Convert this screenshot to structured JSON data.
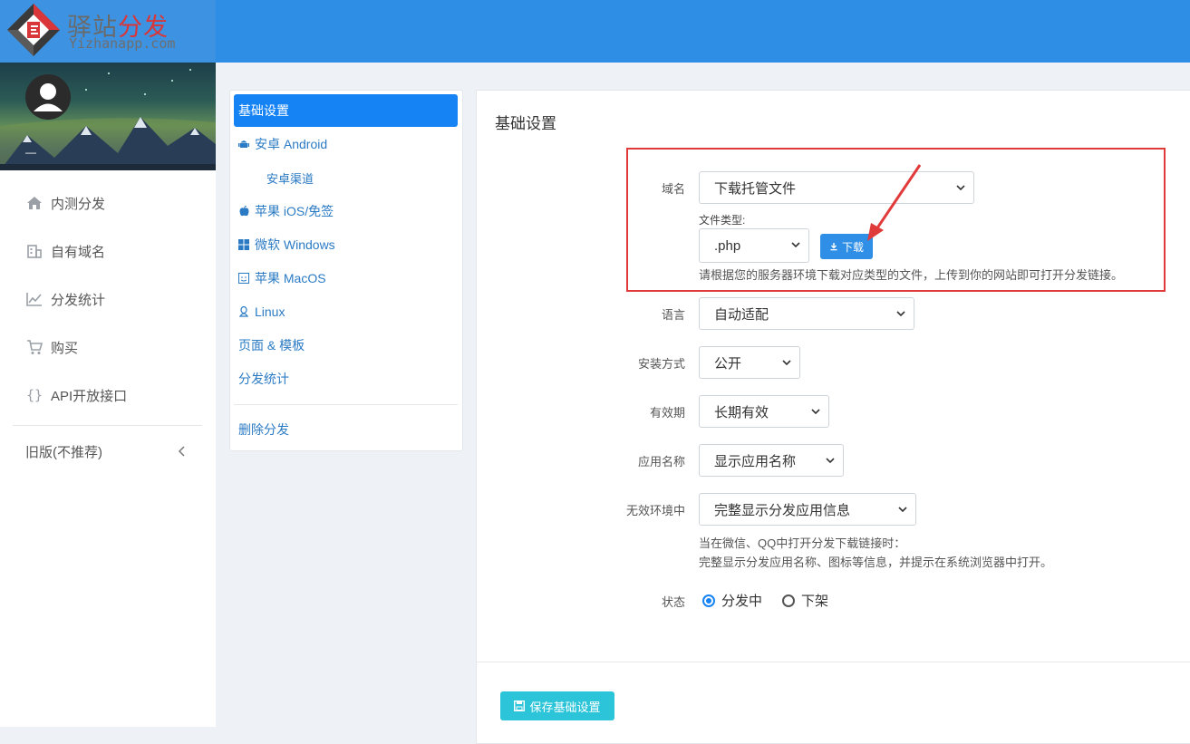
{
  "brand": {
    "name_gray": "驿站",
    "name_red": "分发",
    "domain": "Yizhanapp.com"
  },
  "user": {
    "name": "—"
  },
  "sidebar": {
    "items": [
      {
        "label": "内测分发",
        "icon": "home-icon"
      },
      {
        "label": "自有域名",
        "icon": "building-icon"
      },
      {
        "label": "分发统计",
        "icon": "chart-line-icon"
      },
      {
        "label": "购买",
        "icon": "cart-icon"
      },
      {
        "label": "API开放接口",
        "icon": "braces-icon"
      }
    ],
    "legacy": {
      "label": "旧版(不推荐)",
      "icon": "chevron-left-icon"
    }
  },
  "menu": {
    "items": [
      {
        "label": "基础设置",
        "active": true
      },
      {
        "label": "安卓 Android",
        "icon": "android-icon"
      },
      {
        "label": "安卓渠道",
        "indent": true
      },
      {
        "label": "苹果 iOS/免签",
        "icon": "apple-icon"
      },
      {
        "label": "微软 Windows",
        "icon": "windows-icon"
      },
      {
        "label": "苹果 MacOS",
        "icon": "finder-icon"
      },
      {
        "label": "Linux",
        "icon": "linux-icon"
      },
      {
        "label": "页面 & 模板"
      },
      {
        "label": "分发统计"
      }
    ],
    "delete_label": "删除分发"
  },
  "form": {
    "title": "基础设置",
    "domain": {
      "label": "域名",
      "value": "下载托管文件",
      "file_type_label": "文件类型:",
      "file_type_value": ".php",
      "download_label": "下载",
      "help": "请根据您的服务器环境下载对应类型的文件，上传到你的网站即可打开分发链接。"
    },
    "language": {
      "label": "语言",
      "value": "自动适配"
    },
    "install": {
      "label": "安装方式",
      "value": "公开"
    },
    "validity": {
      "label": "有效期",
      "value": "长期有效"
    },
    "app_name": {
      "label": "应用名称",
      "value": "显示应用名称"
    },
    "invalid_env": {
      "label": "无效环境中",
      "value": "完整显示分发应用信息",
      "help_line1": "当在微信、QQ中打开分发下载链接时：",
      "help_line2": "完整显示分发应用名称、图标等信息，并提示在系统浏览器中打开。"
    },
    "status": {
      "label": "状态",
      "option_on": "分发中",
      "option_off": "下架",
      "selected": "分发中"
    },
    "save_label": "保存基础设置"
  },
  "colors": {
    "topbar": "#2e8ee6",
    "accent": "#1683f5",
    "save": "#2bc4d8",
    "highlight": "#e03a3a"
  }
}
